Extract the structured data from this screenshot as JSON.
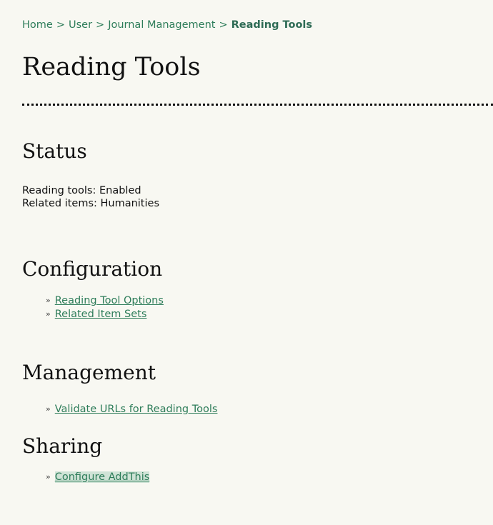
{
  "breadcrumb": {
    "items": [
      "Home",
      "User",
      "Journal Management"
    ],
    "separator": ">",
    "current": "Reading Tools"
  },
  "page_title": "Reading Tools",
  "sections": {
    "status": {
      "heading": "Status",
      "lines": [
        "Reading tools: Enabled",
        "Related items: Humanities"
      ]
    },
    "configuration": {
      "heading": "Configuration",
      "links": [
        "Reading Tool Options",
        "Related Item Sets"
      ]
    },
    "management": {
      "heading": "Management",
      "links": [
        "Validate URLs for Reading Tools"
      ]
    },
    "sharing": {
      "heading": "Sharing",
      "links": [
        "Configure AddThis"
      ]
    }
  },
  "bullet_glyph": "»",
  "colors": {
    "link": "#2e7d5a",
    "background": "#f8f8f2",
    "highlight": "#cfe3d6"
  }
}
